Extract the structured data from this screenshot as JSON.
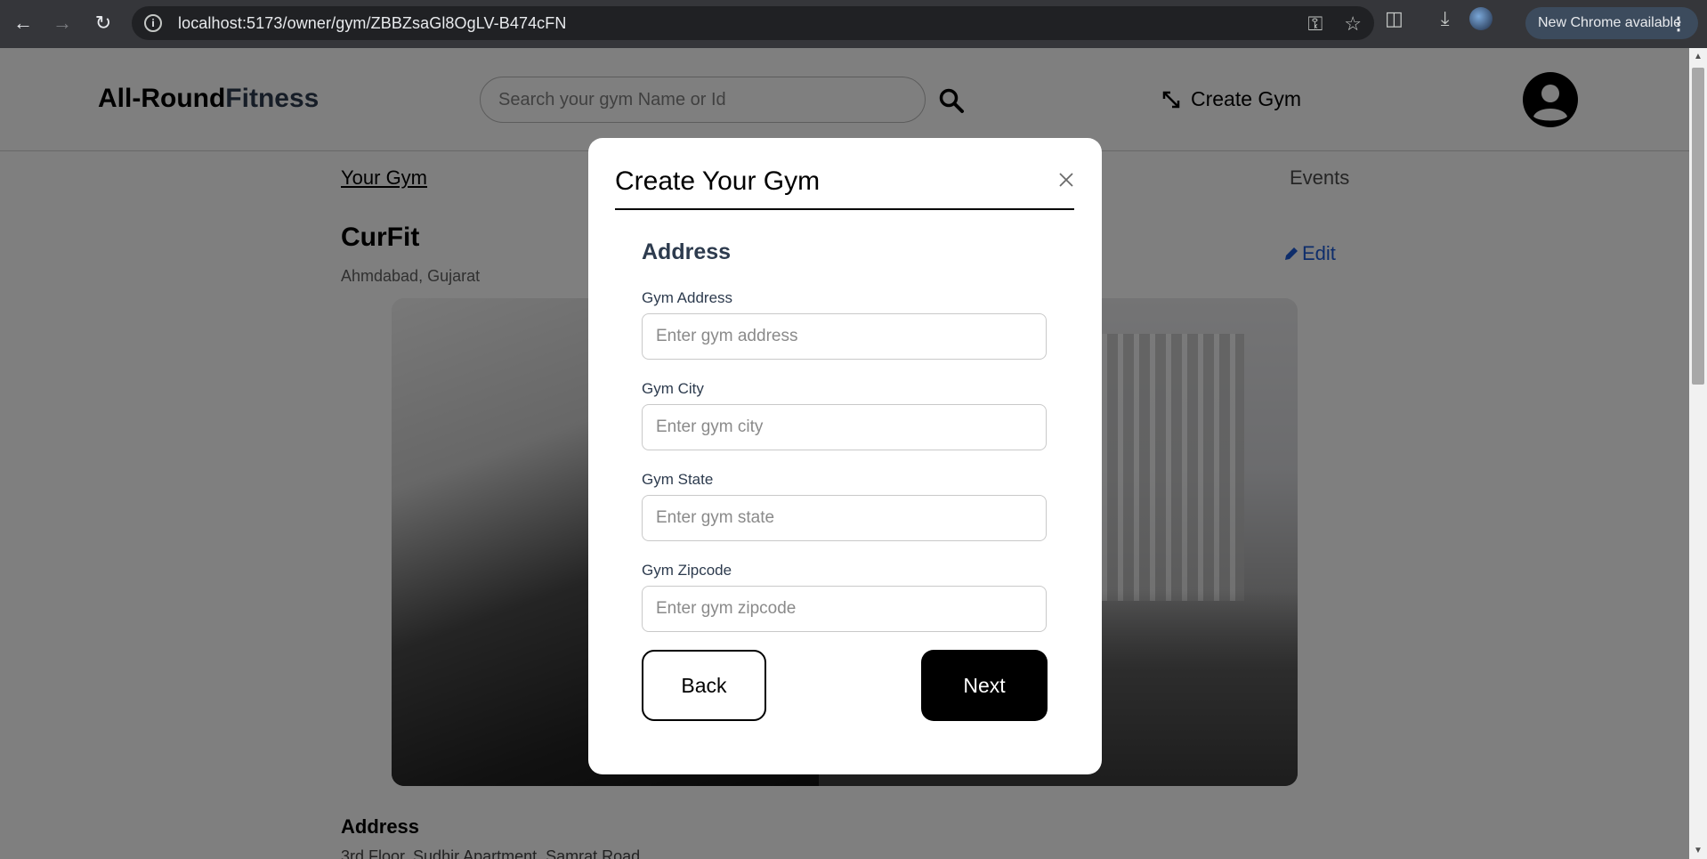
{
  "browser": {
    "url": "localhost:5173/owner/gym/ZBBZsaGl8OgLV-B474cFN",
    "update_label": "New Chrome available"
  },
  "header": {
    "brand_part1": "All-Round",
    "brand_part2": "Fitness",
    "search_placeholder": "Search your gym Name or Id",
    "create_gym_label": "Create Gym"
  },
  "tabs": {
    "your_gym": "Your Gym",
    "events": "Events"
  },
  "gym": {
    "name": "CurFit",
    "location": "Ahmdabad, Gujarat",
    "edit_label": "Edit",
    "section_address": "Address",
    "address_line": "3rd Floor, Sudhir Apartment, Samrat Road"
  },
  "modal": {
    "title": "Create Your Gym",
    "step_title": "Address",
    "fields": [
      {
        "label": "Gym Address",
        "placeholder": "Enter gym address",
        "value": ""
      },
      {
        "label": "Gym City",
        "placeholder": "Enter gym city",
        "value": ""
      },
      {
        "label": "Gym State",
        "placeholder": "Enter gym state",
        "value": ""
      },
      {
        "label": "Gym Zipcode",
        "placeholder": "Enter gym zipcode",
        "value": ""
      }
    ],
    "back_label": "Back",
    "next_label": "Next"
  },
  "colors": {
    "brand_accent": "#2d3b4e",
    "edit_link": "#1c5bd6",
    "primary_button": "#000000",
    "overlay": "rgba(0,0,0,0.5)"
  }
}
